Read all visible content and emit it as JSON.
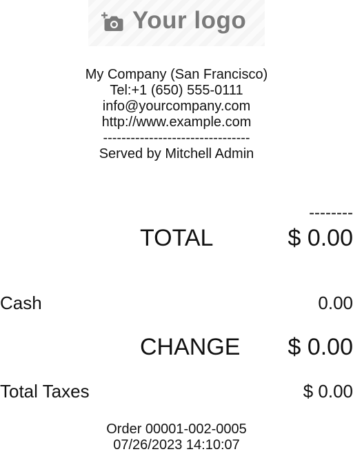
{
  "header": {
    "logo_text": "Your logo",
    "logo_icon": "camera-add-icon"
  },
  "company": {
    "name": "My Company (San Francisco)",
    "phone": "Tel:+1 (650) 555-0111",
    "email": "info@yourcompany.com",
    "website": "http://www.example.com",
    "separator": "--------------------------------",
    "served_by": "Served by Mitchell Admin"
  },
  "totals": {
    "separator": "--------",
    "total_label": "TOTAL",
    "total_amount": "$ 0.00"
  },
  "payment": {
    "method_label": "Cash",
    "method_amount": "0.00",
    "change_label": "CHANGE",
    "change_amount": "$ 0.00"
  },
  "taxes": {
    "label": "Total Taxes",
    "amount": "$ 0.00"
  },
  "order": {
    "reference": "Order 00001-002-0005",
    "datetime": "07/26/2023 14:10:07"
  },
  "colors": {
    "text": "#111111",
    "logo_gray": "#7a7a7a",
    "background": "#ffffff"
  }
}
